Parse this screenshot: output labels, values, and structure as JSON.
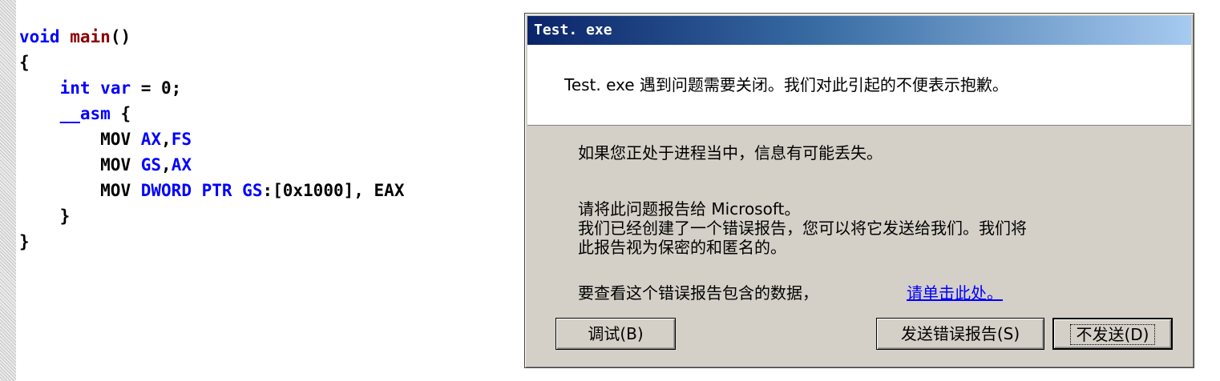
{
  "code": {
    "lines": [
      {
        "kw": "void",
        "fn": "main",
        "rest": "()"
      },
      {
        "text": "{"
      },
      {
        "indent": "    ",
        "kw": "int",
        "rest1": " ",
        "kw2": "var",
        "rest2": " = 0;"
      },
      {
        "indent": "    ",
        "kw": "__asm",
        "rest": " {"
      },
      {
        "indent": "        ",
        "op": "MOV",
        "args": "AX",
        "sep": ",",
        "args2": "FS"
      },
      {
        "indent": "        ",
        "op": "MOV",
        "args": "GS",
        "sep": ",",
        "args2": "AX"
      },
      {
        "indent": "        ",
        "op": "MOV",
        "args": "DWORD PTR GS",
        "sep": ":[0x1000], EAX"
      },
      {
        "text": "    }"
      },
      {
        "text": "}"
      }
    ]
  },
  "dialog": {
    "title": "Test. exe",
    "message": "Test. exe 遇到问题需要关闭。我们对此引起的不便表示抱歉。",
    "info": "如果您正处于进程当中，信息有可能丢失。",
    "report_text": "请将此问题报告给 Microsoft。\n我们已经创建了一个错误报告，您可以将它发送给我们。我们将\n此报告视为保密的和匿名的。",
    "view_text": "要查看这个错误报告包含的数据，",
    "link_text": "请单击此处。",
    "buttons": {
      "debug": "调试(B)",
      "send": "发送错误报告(S)",
      "dont_send": "不发送(D)"
    }
  }
}
